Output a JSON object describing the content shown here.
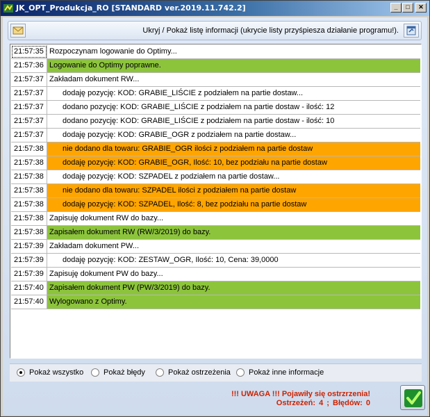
{
  "window": {
    "title": "JK_OPT_Produkcja_RO [STANDARD ver.2019.11.742.2]",
    "controls": {
      "minimize": "_",
      "maximize": "□",
      "close": "✕"
    }
  },
  "toolbar": {
    "toggle_label": "Ukryj / Pokaż listę informacji (ukrycie listy przyśpiesza działanie programu!).",
    "left_icon": "envelope-icon",
    "right_icon": "info-window-icon"
  },
  "colors": {
    "ok": "#8cc43c",
    "warn": "#ffa500",
    "info": "#ffffff",
    "alert_text": "#cc2200"
  },
  "log": [
    {
      "time": "21:57:35",
      "text": "Rozpoczynam logowanie do Optimy...",
      "type": "info",
      "indent": 0
    },
    {
      "time": "21:57:36",
      "text": "Logowanie do Optimy poprawne.",
      "type": "ok",
      "indent": 0
    },
    {
      "time": "21:57:37",
      "text": "Zakładam dokument RW...",
      "type": "info",
      "indent": 0
    },
    {
      "time": "21:57:37",
      "text": "dodaję pozycję: KOD: GRABIE_LIŚCIE z podziałem na partie dostaw...",
      "type": "info",
      "indent": 1
    },
    {
      "time": "21:57:37",
      "text": "dodano pozycję: KOD: GRABIE_LIŚCIE z podziałem na partie dostaw - ilość: 12",
      "type": "info",
      "indent": 1
    },
    {
      "time": "21:57:37",
      "text": "dodano pozycję: KOD: GRABIE_LIŚCIE z podziałem na partie dostaw - ilość: 10",
      "type": "info",
      "indent": 1
    },
    {
      "time": "21:57:37",
      "text": "dodaję pozycję: KOD: GRABIE_OGR z podziałem na partie dostaw...",
      "type": "info",
      "indent": 1
    },
    {
      "time": "21:57:38",
      "text": "nie dodano dla towaru: GRABIE_OGR ilości z podziałem na partie dostaw",
      "type": "warn",
      "indent": 1
    },
    {
      "time": "21:57:38",
      "text": "dodaję pozycję: KOD: GRABIE_OGR, Ilość: 10, bez podziału na partie dostaw",
      "type": "warn",
      "indent": 1
    },
    {
      "time": "21:57:38",
      "text": "dodaję pozycję: KOD: SZPADEL z podziałem na partie dostaw...",
      "type": "info",
      "indent": 1
    },
    {
      "time": "21:57:38",
      "text": "nie dodano dla towaru: SZPADEL ilości z podziałem na partie dostaw",
      "type": "warn",
      "indent": 1
    },
    {
      "time": "21:57:38",
      "text": "dodaję pozycję: KOD: SZPADEL, Ilość: 8, bez podziału na partie dostaw",
      "type": "warn",
      "indent": 1
    },
    {
      "time": "21:57:38",
      "text": "Zapisuję dokument RW do bazy...",
      "type": "info",
      "indent": 0
    },
    {
      "time": "21:57:38",
      "text": "Zapisałem dokument RW (RW/3/2019) do bazy.",
      "type": "ok",
      "indent": 0
    },
    {
      "time": "21:57:39",
      "text": "Zakładam dokument PW...",
      "type": "info",
      "indent": 0
    },
    {
      "time": "21:57:39",
      "text": "dodaję pozycję: KOD: ZESTAW_OGR, Ilość: 10, Cena: 39,0000",
      "type": "info",
      "indent": 1
    },
    {
      "time": "21:57:39",
      "text": "Zapisuję dokument PW do bazy...",
      "type": "info",
      "indent": 0
    },
    {
      "time": "21:57:40",
      "text": "Zapisałem dokument PW (PW/3/2019) do bazy.",
      "type": "ok",
      "indent": 0
    },
    {
      "time": "21:57:40",
      "text": "Wylogowano z Optimy.",
      "type": "ok",
      "indent": 0
    }
  ],
  "filters": [
    {
      "label": "Pokaż wszystko",
      "checked": true
    },
    {
      "label": "Pokaż błędy",
      "checked": false
    },
    {
      "label": "Pokaż ostrzeżenia",
      "checked": false
    },
    {
      "label": "Pokaż inne informacje",
      "checked": false
    }
  ],
  "status": {
    "warning_text": "!!! UWAGA !!! Pojawiły się ostrzrzenia!",
    "warnings_label": "Ostrzeżeń:",
    "warnings_count": "4",
    "separator": ";",
    "errors_label": "Błędów:",
    "errors_count": "0"
  },
  "ok_button": {
    "icon": "checkmark-icon"
  }
}
